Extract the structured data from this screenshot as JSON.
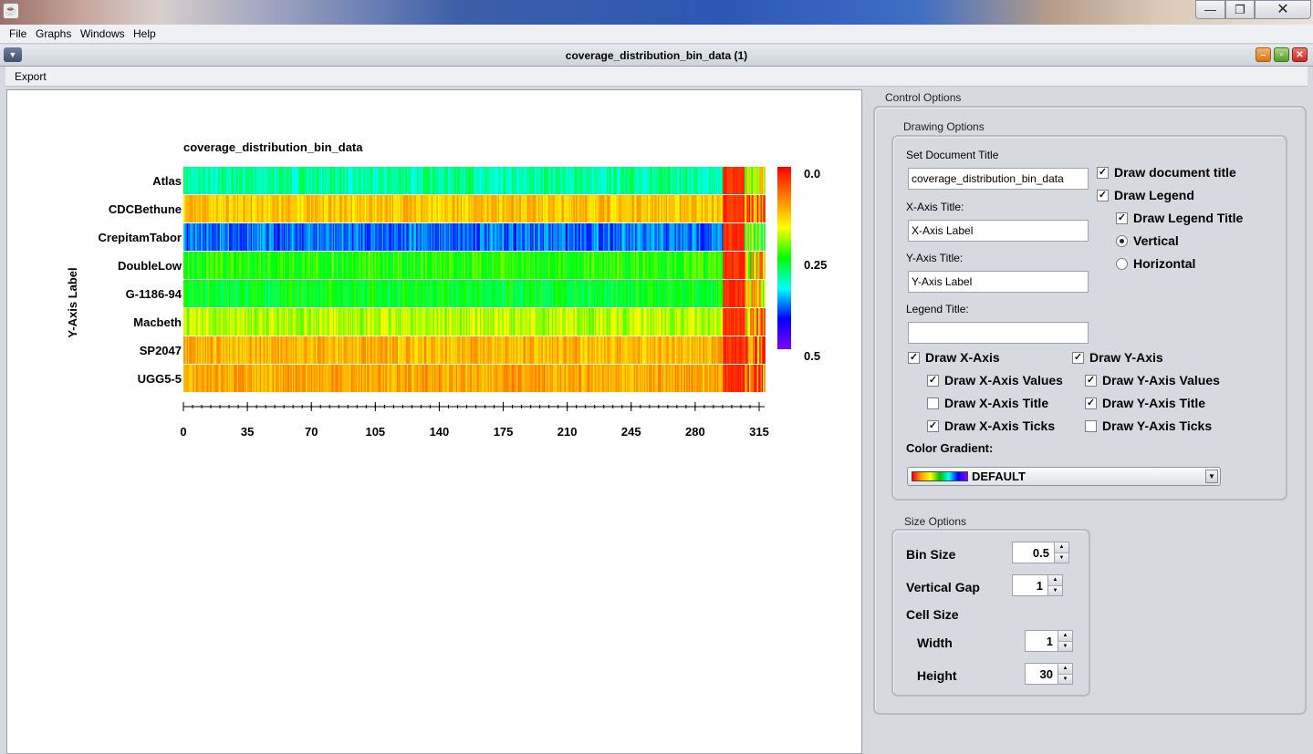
{
  "window": {
    "icon_glyph": "☕",
    "min_glyph": "—",
    "max_glyph": "❐",
    "close_glyph": "✕"
  },
  "menubar": [
    "File",
    "Graphs",
    "Windows",
    "Help"
  ],
  "internal_frame": {
    "title": "coverage_distribution_bin_data (1)",
    "menu_glyph": "▼",
    "min_glyph": "–",
    "max_glyph": "▫",
    "close_glyph": "✕",
    "menu": [
      "Export"
    ]
  },
  "chart_data": {
    "type": "heatmap",
    "title": "coverage_distribution_bin_data",
    "xlabel": "",
    "ylabel": "Y-Axis Label",
    "rows": [
      "Atlas",
      "CDCBethune",
      "CrepitamTabor",
      "DoubleLow",
      "G-1186-94",
      "Macbeth",
      "SP2047",
      "UGG5-5"
    ],
    "row_base_values": [
      0.3,
      0.13,
      0.38,
      0.24,
      0.26,
      0.19,
      0.12,
      0.11
    ],
    "x_ticks": [
      "0",
      "35",
      "70",
      "105",
      "140",
      "175",
      "210",
      "245",
      "280",
      "315"
    ],
    "xlim": [
      0,
      318
    ],
    "high_coverage_region": [
      295,
      318
    ],
    "high_coverage_value": 0.01,
    "legend": {
      "ticks": [
        "0.0",
        "0.25",
        "0.5"
      ],
      "range": [
        0.0,
        0.5
      ],
      "orientation": "vertical"
    },
    "colors": [
      "#ff0000",
      "#ff8000",
      "#ffff00",
      "#00ff00",
      "#00ffff",
      "#0000ff",
      "#8000ff"
    ]
  },
  "control_panel": {
    "title": "Control Options",
    "drawing_options": {
      "title": "Drawing Options",
      "set_doc_title_label": "Set Document Title",
      "doc_title_value": "coverage_distribution_bin_data",
      "x_axis_title_label": "X-Axis Title:",
      "x_axis_title_value": "X-Axis Label",
      "y_axis_title_label": "Y-Axis Title:",
      "y_axis_title_value": "Y-Axis Label",
      "legend_title_label": "Legend Title:",
      "legend_title_value": "",
      "draw_document_title": "Draw document title",
      "draw_legend": "Draw Legend",
      "draw_legend_title": "Draw Legend Title",
      "vertical": "Vertical",
      "horizontal": "Horizontal",
      "draw_x_axis": "Draw X-Axis",
      "draw_y_axis": "Draw Y-Axis",
      "draw_x_axis_values": "Draw X-Axis Values",
      "draw_y_axis_values": "Draw Y-Axis Values",
      "draw_x_axis_title": "Draw X-Axis Title",
      "draw_y_axis_title": "Draw Y-Axis Title",
      "draw_x_axis_ticks": "Draw X-Axis Ticks",
      "draw_y_axis_ticks": "Draw Y-Axis Ticks",
      "checked_glyph": "✓",
      "color_gradient_label": "Color Gradient:",
      "color_gradient_value": "DEFAULT",
      "dropdown_glyph": "▼"
    },
    "size_options": {
      "title": "Size Options",
      "bin_size_label": "Bin Size",
      "bin_size_value": "0.5",
      "vertical_gap_label": "Vertical Gap",
      "vertical_gap_value": "1",
      "cell_size_label": "Cell Size",
      "width_label": "Width",
      "width_value": "1",
      "height_label": "Height",
      "height_value": "30",
      "up_glyph": "▲",
      "down_glyph": "▼"
    }
  }
}
